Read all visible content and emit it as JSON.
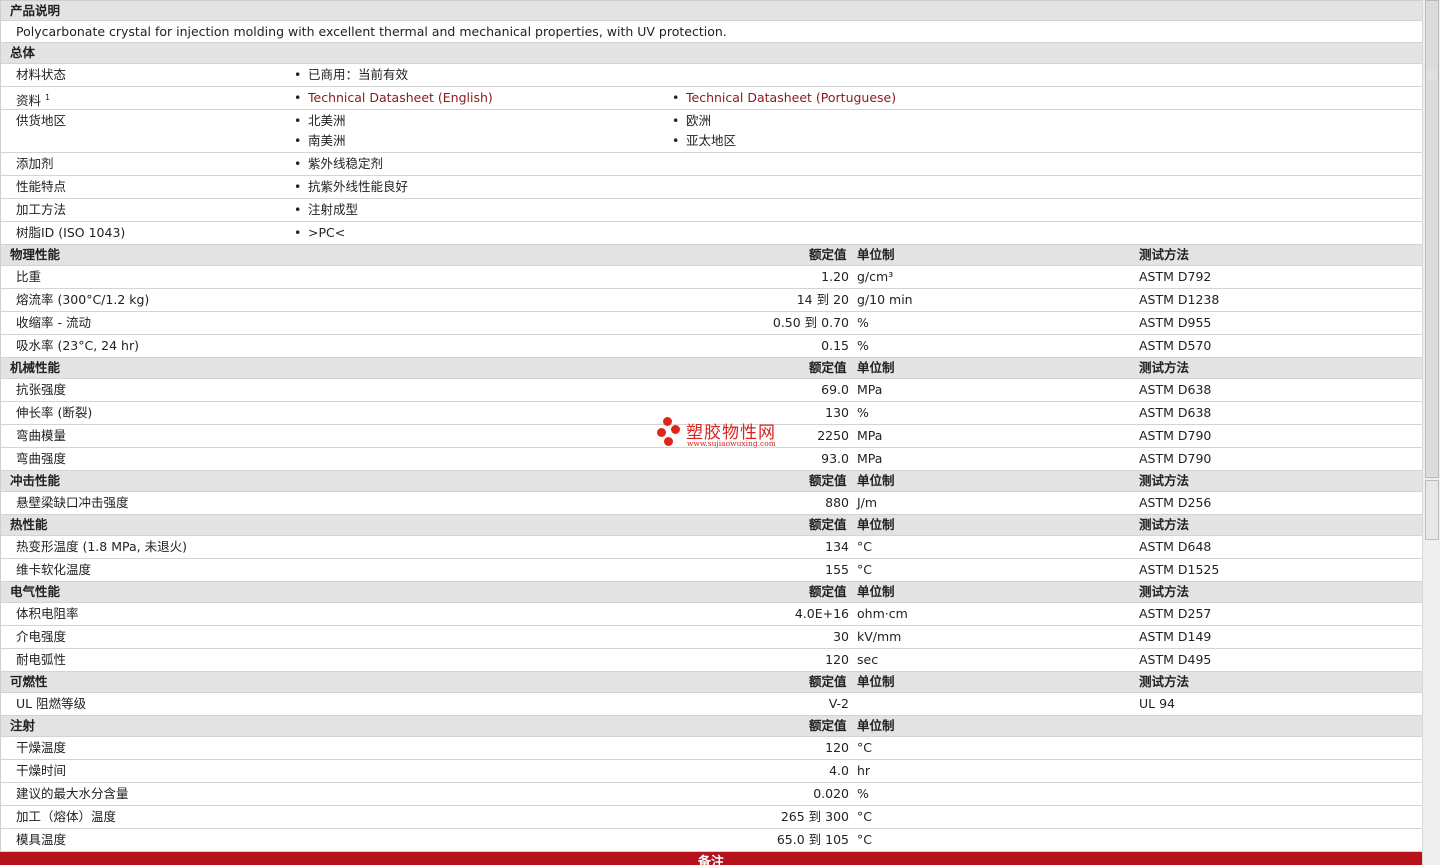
{
  "description": {
    "heading": "产品说明",
    "text": "Polycarbonate crystal for injection molding with excellent thermal and mechanical properties, with UV protection."
  },
  "general": {
    "heading": "总体",
    "rows": [
      {
        "label": "材料状态",
        "sup": "",
        "col1": [
          "已商用：当前有效"
        ],
        "col2": []
      },
      {
        "label": "资料",
        "sup": "1",
        "col1": [
          "Technical Datasheet (English)"
        ],
        "col2": [
          "Technical Datasheet (Portuguese)"
        ],
        "links": true
      },
      {
        "label": "供货地区",
        "sup": "",
        "col1": [
          "北美洲",
          "南美洲"
        ],
        "col2": [
          "欧洲",
          "亚太地区"
        ]
      },
      {
        "label": "添加剂",
        "sup": "",
        "col1": [
          "紫外线稳定剂"
        ],
        "col2": []
      },
      {
        "label": "性能特点",
        "sup": "",
        "col1": [
          "抗紫外线性能良好"
        ],
        "col2": []
      },
      {
        "label": "加工方法",
        "sup": "",
        "col1": [
          "注射成型"
        ],
        "col2": []
      },
      {
        "label": "树脂ID (ISO 1043)",
        "sup": "",
        "col1": [
          ">PC<"
        ],
        "col2": []
      }
    ]
  },
  "headers": {
    "value": "额定值",
    "unit": "单位制",
    "method": "测试方法"
  },
  "sections": [
    {
      "title": "物理性能",
      "show_method": true,
      "rows": [
        {
          "label": "比重",
          "value": "1.20",
          "unit": "g/cm³",
          "method": "ASTM D792"
        },
        {
          "label": "熔流率 (300°C/1.2 kg)",
          "value": "14 到  20",
          "unit": "g/10 min",
          "method": "ASTM D1238"
        },
        {
          "label": "收缩率 - 流动",
          "value": "0.50 到  0.70",
          "unit": "%",
          "method": "ASTM D955"
        },
        {
          "label": "吸水率 (23°C, 24 hr)",
          "value": "0.15",
          "unit": "%",
          "method": "ASTM D570"
        }
      ]
    },
    {
      "title": "机械性能",
      "show_method": true,
      "rows": [
        {
          "label": "抗张强度",
          "value": "69.0",
          "unit": "MPa",
          "method": "ASTM D638"
        },
        {
          "label": "伸长率 (断裂)",
          "value": "130",
          "unit": "%",
          "method": "ASTM D638"
        },
        {
          "label": "弯曲模量",
          "value": "2250",
          "unit": "MPa",
          "method": "ASTM D790"
        },
        {
          "label": "弯曲强度",
          "value": "93.0",
          "unit": "MPa",
          "method": "ASTM D790"
        }
      ]
    },
    {
      "title": "冲击性能",
      "show_method": true,
      "rows": [
        {
          "label": "悬壁梁缺口冲击强度",
          "value": "880",
          "unit": "J/m",
          "method": "ASTM D256"
        }
      ]
    },
    {
      "title": "热性能",
      "show_method": true,
      "rows": [
        {
          "label": "热变形温度 (1.8 MPa, 未退火)",
          "value": "134",
          "unit": "°C",
          "method": "ASTM D648"
        },
        {
          "label": "维卡软化温度",
          "value": "155",
          "unit": "°C",
          "method": "ASTM D1525"
        }
      ]
    },
    {
      "title": "电气性能",
      "show_method": true,
      "rows": [
        {
          "label": "体积电阻率",
          "value": "4.0E+16",
          "unit": "ohm·cm",
          "method": "ASTM D257"
        },
        {
          "label": "介电强度",
          "value": "30",
          "unit": "kV/mm",
          "method": "ASTM D149"
        },
        {
          "label": "耐电弧性",
          "value": "120",
          "unit": "sec",
          "method": "ASTM D495"
        }
      ]
    },
    {
      "title": "可燃性",
      "show_method": true,
      "rows": [
        {
          "label": "UL 阻燃等级",
          "value": "V-2",
          "unit": "",
          "method": "UL 94"
        }
      ]
    },
    {
      "title": "注射",
      "show_method": false,
      "rows": [
        {
          "label": "干燥温度",
          "value": "120",
          "unit": "°C",
          "method": ""
        },
        {
          "label": "干燥时间",
          "value": "4.0",
          "unit": "hr",
          "method": ""
        },
        {
          "label": "建议的最大水分含量",
          "value": "0.020",
          "unit": "%",
          "method": ""
        },
        {
          "label": "加工（熔体）温度",
          "value": "265 到  300",
          "unit": "°C",
          "method": ""
        },
        {
          "label": "模具温度",
          "value": "65.0 到  105",
          "unit": "°C",
          "method": ""
        }
      ]
    }
  ],
  "footer": {
    "label": "备注"
  },
  "watermark": {
    "title": "塑胶物性网",
    "url": "www.sujiaowuxing.com"
  },
  "colors": {
    "section_bg": "#e3e3e3",
    "link": "#8a1a1a",
    "footer_bg": "#b5121b",
    "watermark": "#d9241c"
  }
}
